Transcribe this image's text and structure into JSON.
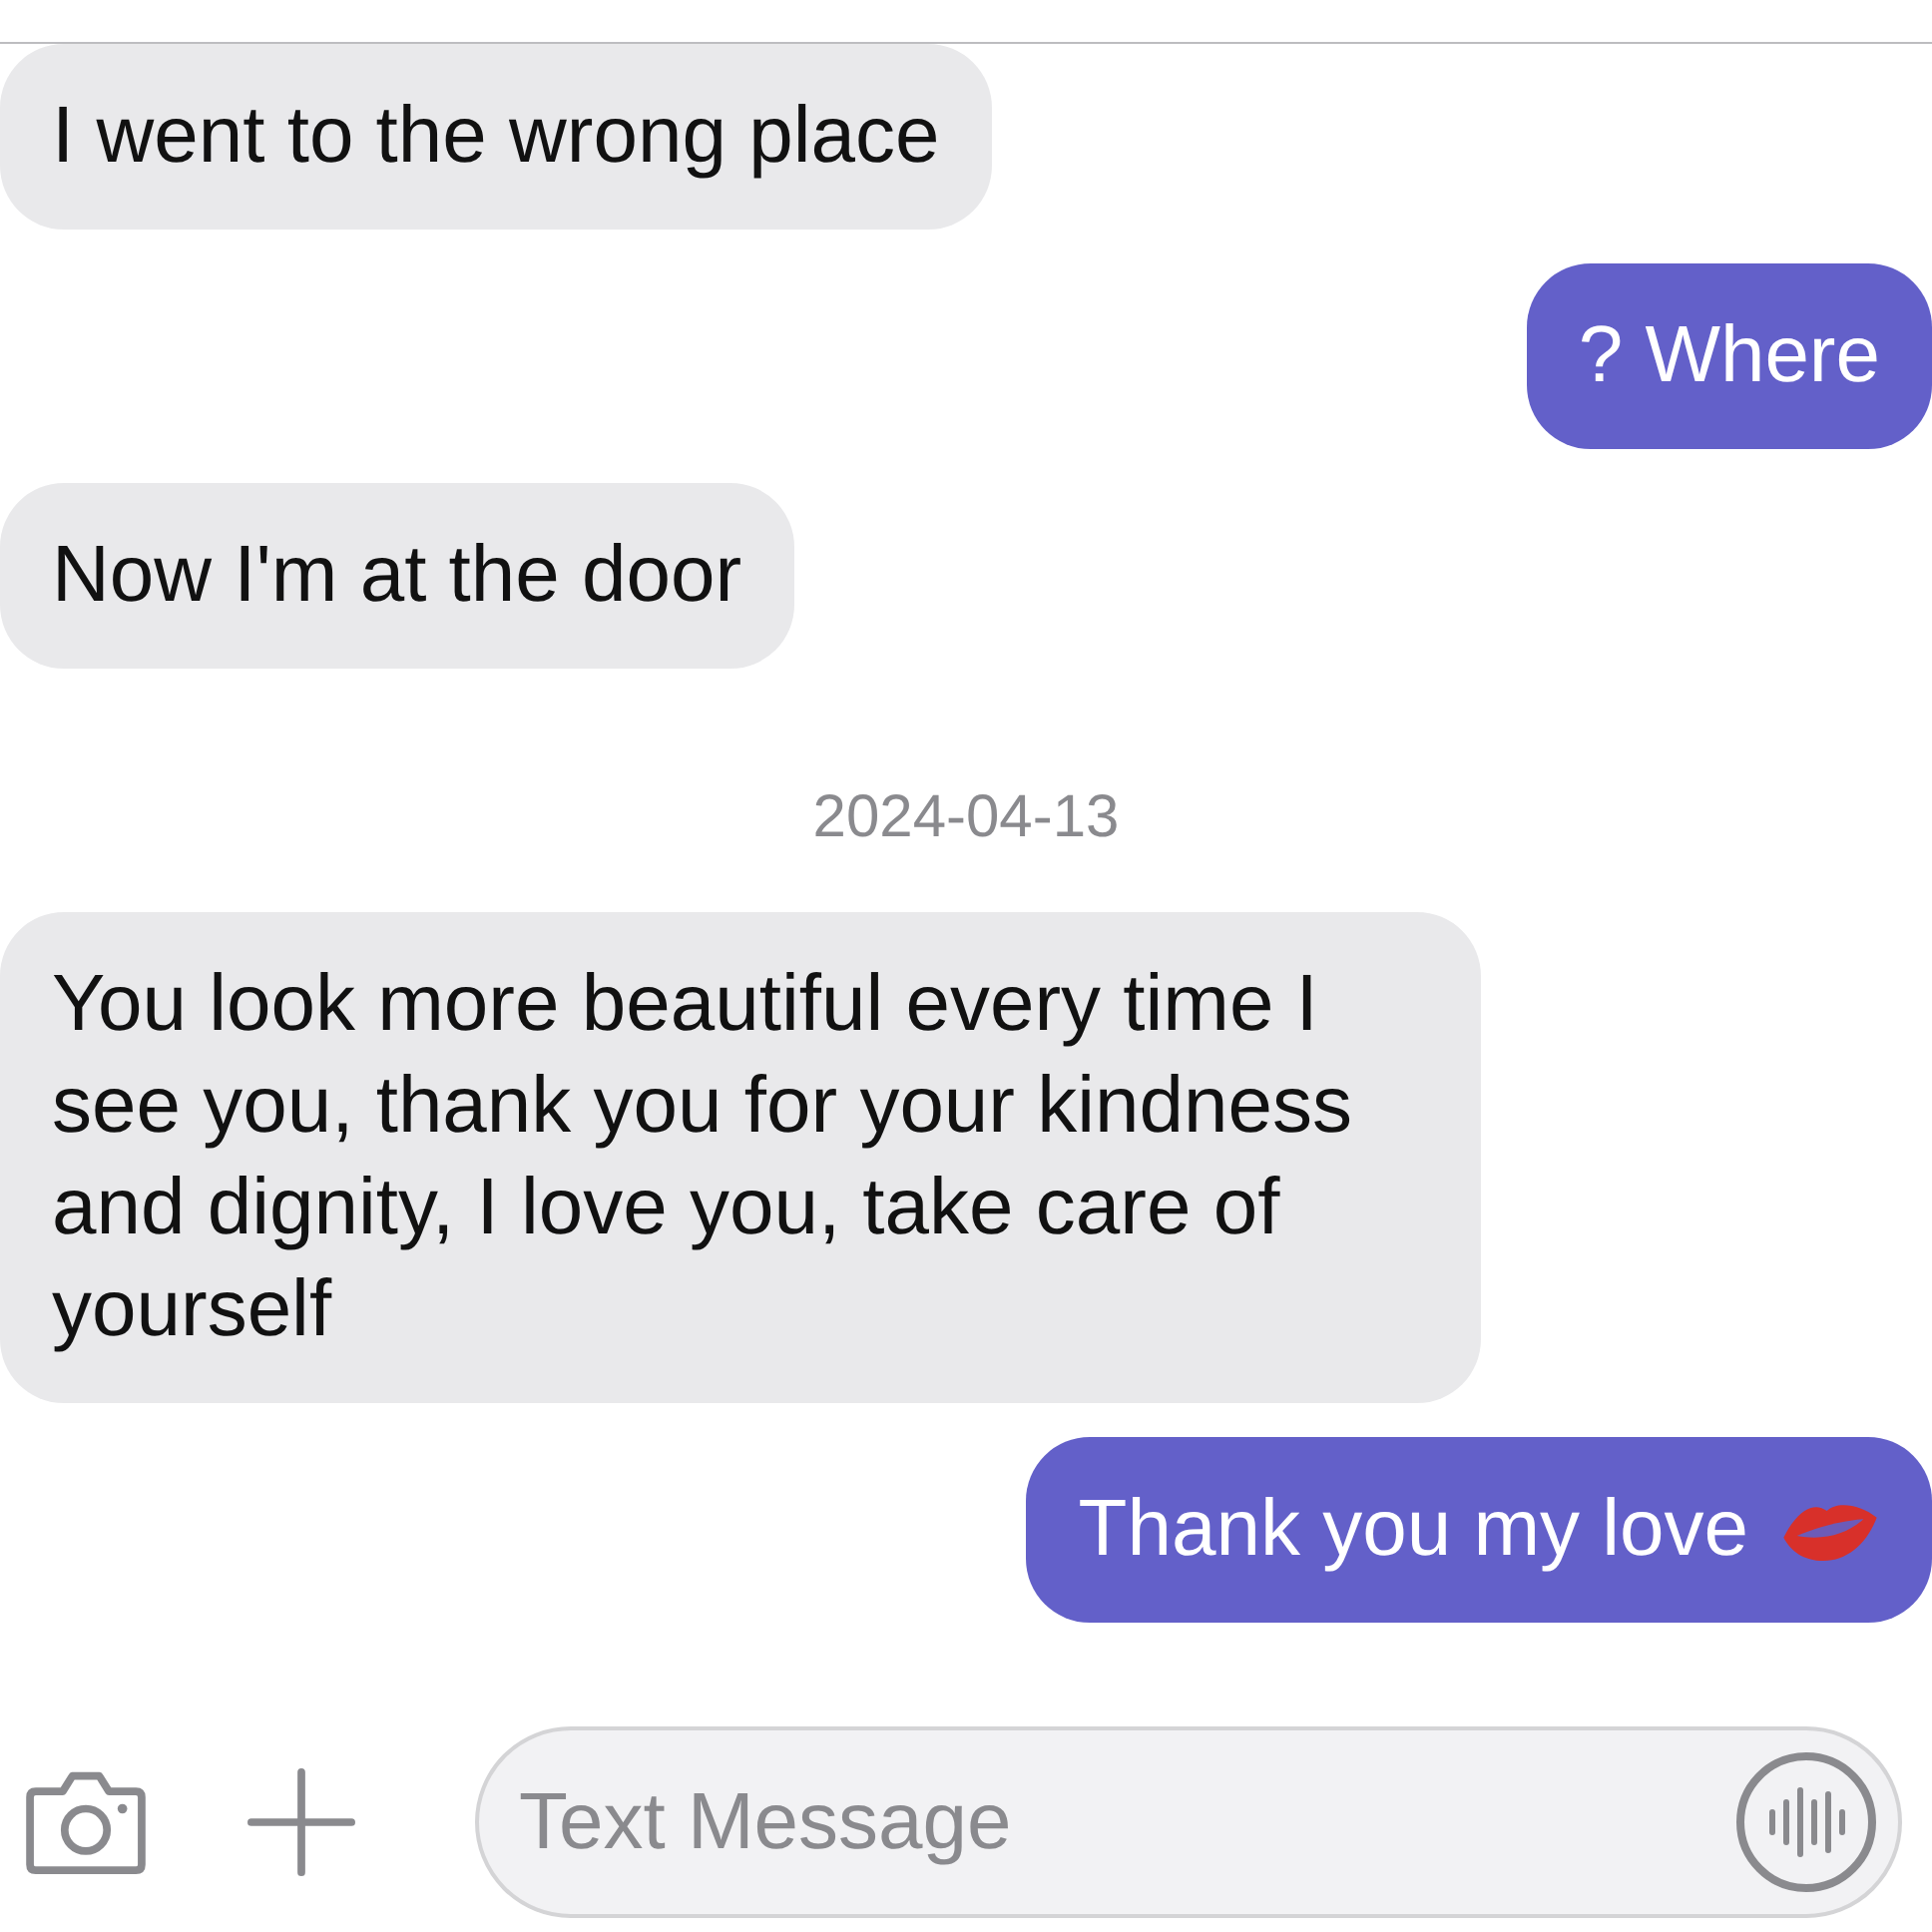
{
  "messages": [
    {
      "kind": "received",
      "text": "I went to the wrong place"
    },
    {
      "kind": "sent",
      "text": "? Where"
    },
    {
      "kind": "received",
      "text": "Now I'm at the door"
    },
    {
      "kind": "date",
      "text": "2024-04-13"
    },
    {
      "kind": "received",
      "text": "You look more beautiful every time I see you, thank you for your kindness and dignity, I love you, take care of yourself"
    },
    {
      "kind": "sent",
      "text": "Thank you my love",
      "has_icon": true
    }
  ],
  "composer": {
    "placeholder": "Text Message"
  }
}
